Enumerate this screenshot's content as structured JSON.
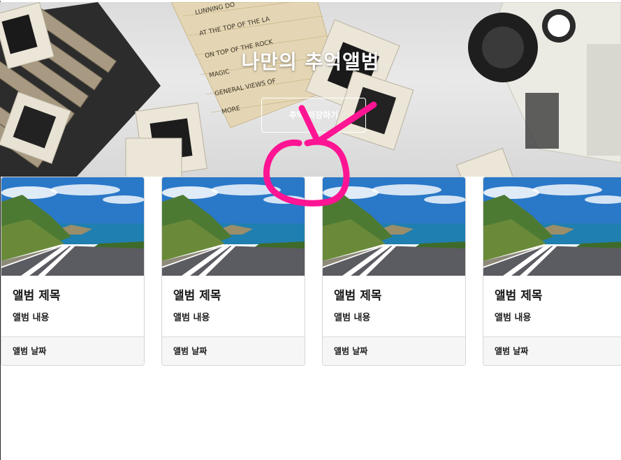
{
  "hero": {
    "title": "나만의 추억앨범",
    "button_label": "추억 저장하기",
    "notes": [
      "LUNNING DO",
      "AT THE TOP OF THE LA",
      "ON TOP OF THE ROCK",
      "MAGIC",
      "GENERAL VIEWS OF",
      "MORE"
    ]
  },
  "cards": [
    {
      "title": "앨범 제목",
      "text": "앨범 내용",
      "date": "앨범 날짜"
    },
    {
      "title": "앨범 제목",
      "text": "앨범 내용",
      "date": "앨범 날짜"
    },
    {
      "title": "앨범 제목",
      "text": "앨범 내용",
      "date": "앨범 날짜"
    },
    {
      "title": "앨범 제목",
      "text": "앨범 내용",
      "date": "앨범 날짜"
    }
  ],
  "colors": {
    "annotation": "#ff1493",
    "card_footer": "#f6f6f6",
    "sea": "#1f7fb0",
    "sky": "#2a78c8"
  },
  "icons": [
    "photo-slide-icon",
    "projector-icon",
    "road-landscape-icon"
  ]
}
